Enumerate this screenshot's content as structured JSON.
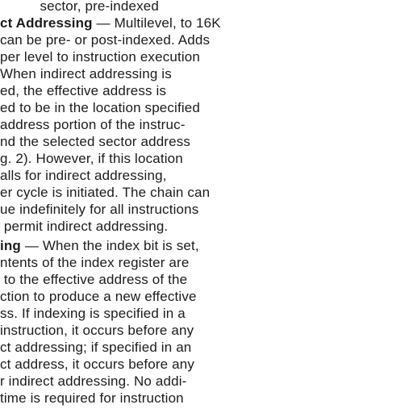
{
  "document": {
    "top_line": "    sector, pre-indexed",
    "section_indirect": {
      "heading": "ct Addressing",
      "dash": " — ",
      "lines": [
        "Multilevel, to 16K",
        "can be pre- or post-indexed. Adds",
        "per level to instruction execution",
        "When indirect addressing is",
        "ed, the effective address is",
        "ed to be in the location specified",
        "address portion of the instruc-",
        "nd the selected sector address",
        "g. 2). However, if this location",
        "alls for indirect addressing,",
        "er cycle is initiated. The chain can",
        "ue indefinitely for all instructions",
        " permit indirect addressing."
      ]
    },
    "section_indexing": {
      "heading": "ing",
      "dash": " — ",
      "lines": [
        "When the index bit is set,",
        "ntents of the index register are",
        " to the effective address of the",
        "ction to produce a new effective",
        "ss. If indexing is specified in a",
        "instruction, it occurs before any",
        "ct addressing; if specified in an",
        "ct address, it occurs before any",
        "r indirect addressing. No addi-",
        "time is required for instruction"
      ]
    }
  }
}
